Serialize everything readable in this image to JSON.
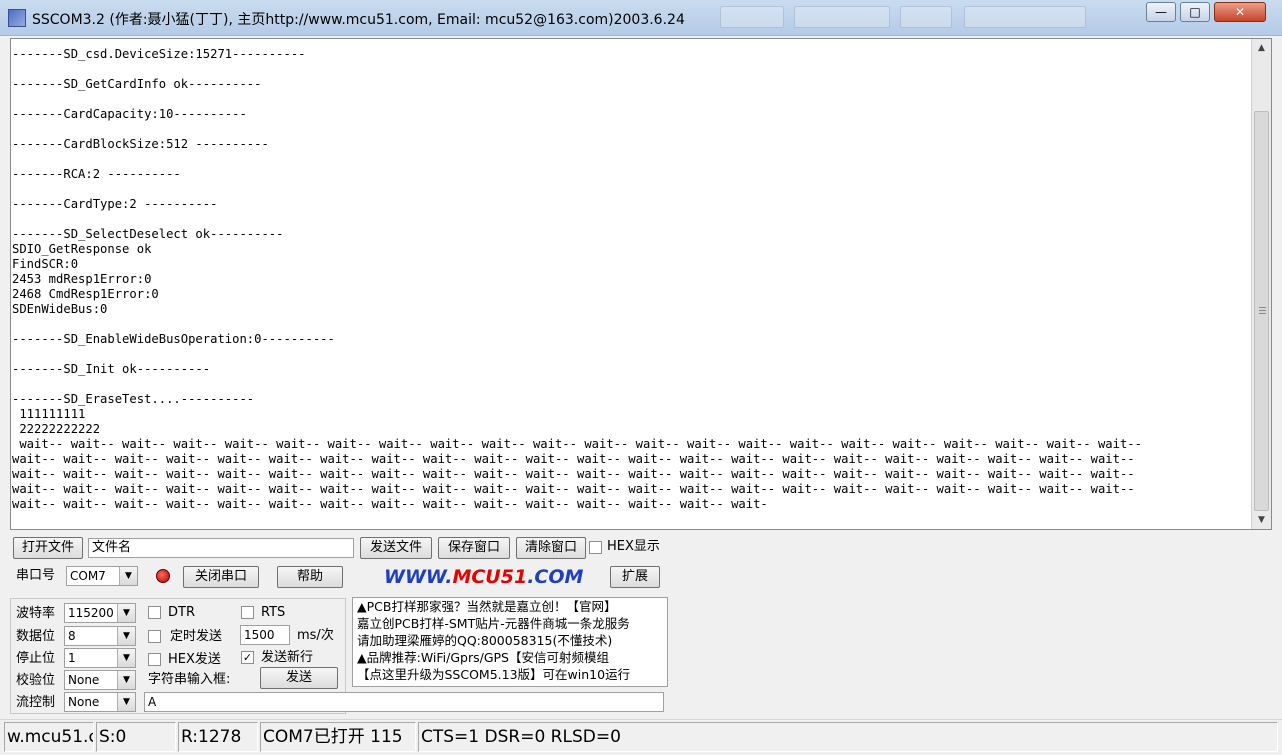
{
  "window": {
    "title": "SSCOM3.2 (作者:聂小猛(丁丁), 主页http://www.mcu51.com,  Email: mcu52@163.com)2003.6.24",
    "minimize": "—",
    "maximize": "□",
    "close": "✕"
  },
  "receive": {
    "lines": [
      "-------SD_csd.DeviceSize:15271----------",
      "",
      "-------SD_GetCardInfo ok----------",
      "",
      "-------CardCapacity:10----------",
      "",
      "-------CardBlockSize:512 ----------",
      "",
      "-------RCA:2 ----------",
      "",
      "-------CardType:2 ----------",
      "",
      "-------SD_SelectDeselect ok----------",
      "SDIO_GetResponse ok",
      "FindSCR:0",
      "2453 mdResp1Error:0",
      "2468 CmdResp1Error:0",
      "SDEnWideBus:0",
      "",
      "-------SD_EnableWideBusOperation:0----------",
      "",
      "-------SD_Init ok----------",
      "",
      "-------SD_EraseTest....----------",
      " 111111111",
      " 22222222222",
      " wait-- wait-- wait-- wait-- wait-- wait-- wait-- wait-- wait-- wait-- wait-- wait-- wait-- wait-- wait-- wait-- wait-- wait-- wait-- wait-- wait-- wait--",
      "wait-- wait-- wait-- wait-- wait-- wait-- wait-- wait-- wait-- wait-- wait-- wait-- wait-- wait-- wait-- wait-- wait-- wait-- wait-- wait-- wait-- wait--",
      "wait-- wait-- wait-- wait-- wait-- wait-- wait-- wait-- wait-- wait-- wait-- wait-- wait-- wait-- wait-- wait-- wait-- wait-- wait-- wait-- wait-- wait--",
      "wait-- wait-- wait-- wait-- wait-- wait-- wait-- wait-- wait-- wait-- wait-- wait-- wait-- wait-- wait-- wait-- wait-- wait-- wait-- wait-- wait-- wait--",
      "wait-- wait-- wait-- wait-- wait-- wait-- wait-- wait-- wait-- wait-- wait-- wait-- wait-- wait-- wait-"
    ]
  },
  "file_row": {
    "open_file": "打开文件",
    "filename_value": "文件名",
    "send_file": "发送文件",
    "save_window": "保存窗口",
    "clear_window": "清除窗口",
    "hex_display": "HEX显示",
    "hex_display_checked": false
  },
  "port_row": {
    "port_label": "串口号",
    "port_value": "COM7",
    "close_port": "关闭串口",
    "help": "帮助",
    "logo_prefix": "WWW.",
    "logo_mid": "MCU51",
    "logo_suffix": ".COM",
    "expand": "扩展"
  },
  "settings": {
    "baud_label": "波特率",
    "baud_value": "115200",
    "data_label": "数据位",
    "data_value": "8",
    "stop_label": "停止位",
    "stop_value": "1",
    "parity_label": "校验位",
    "parity_value": "None",
    "flow_label": "流控制",
    "flow_value": "None"
  },
  "options": {
    "dtr": "DTR",
    "dtr_checked": false,
    "rts": "RTS",
    "rts_checked": false,
    "timed_send": "定时发送",
    "timed_send_checked": false,
    "interval_value": "1500",
    "interval_unit": "ms/次",
    "hex_send": "HEX发送",
    "hex_send_checked": false,
    "send_newline": "发送新行",
    "send_newline_checked": true,
    "string_input_label": "字符串输入框:",
    "send_button": "发送",
    "send_text_value": "A",
    "check_mark": "✓"
  },
  "ads": {
    "lines": [
      "▲PCB打样那家强？当然就是嘉立创！【官网】",
      "嘉立创PCB打样-SMT贴片-元器件商城一条龙服务",
      "请加助理梁雁婷的QQ:800058315(不懂技术)",
      "▲品牌推荐:WiFi/Gprs/GPS【安信可射频模组",
      "【点这里升级为SSCOM5.13版】可在win10运行"
    ]
  },
  "status": {
    "site": "w.mcu51.c",
    "sent": "S:0",
    "received": "R:1278",
    "port_state": "COM7已打开  115",
    "signals": "CTS=1 DSR=0 RLSD=0"
  },
  "icons": {
    "dropdown": "▼",
    "scroll_up": "▲",
    "scroll_down": "▼"
  }
}
